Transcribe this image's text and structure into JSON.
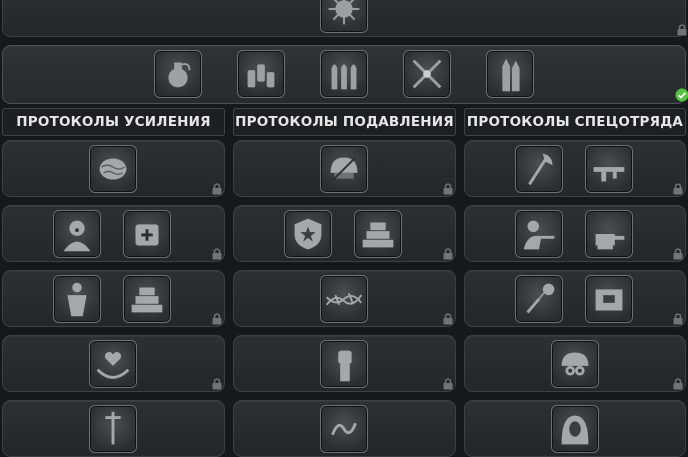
{
  "columns": [
    {
      "title": "ПРОТОКОЛЫ УСИЛЕНИЯ"
    },
    {
      "title": "ПРОТОКОЛЫ ПОДАВЛЕНИЯ"
    },
    {
      "title": "ПРОТОКОЛЫ СПЕЦОТРЯДА"
    }
  ],
  "top_row": {
    "icon": "virus-icon",
    "status": "locked"
  },
  "selected_row": {
    "status": "unlocked",
    "icons": [
      "grenade-icon",
      "ammo-icon",
      "bullets-icon",
      "crossed-rifles-icon",
      "rocket-icon"
    ]
  },
  "rows": [
    {
      "cells": [
        [
          "brain-icon"
        ],
        [
          "riot-helmet-icon"
        ],
        [
          "fire-axe-icon",
          "assault-rifle-icon"
        ]
      ]
    },
    {
      "cells": [
        [
          "screaming-soldier-icon",
          "medkit-icon"
        ],
        [
          "police-badge-icon",
          "sandbag-wall-icon"
        ],
        [
          "sniper-icon",
          "turret-icon"
        ]
      ]
    },
    {
      "cells": [
        [
          "muscle-man-icon",
          "sandbag-wall-icon"
        ],
        [
          "barbed-wire-icon"
        ],
        [
          "flail-icon",
          "supply-crate-icon"
        ]
      ]
    },
    {
      "cells": [
        [
          "healing-hands-icon"
        ],
        [
          "raised-fist-icon"
        ],
        [
          "night-vision-helmet-icon"
        ]
      ]
    },
    {
      "cells": [
        [
          "sword-icon"
        ],
        [
          "snake-icon"
        ],
        [
          "hooded-face-icon"
        ]
      ]
    }
  ],
  "colors": {
    "accent_check": "#55c244",
    "panel": "#2b3032",
    "header_text": "#e6e8e8",
    "lock": "#7d8386"
  }
}
